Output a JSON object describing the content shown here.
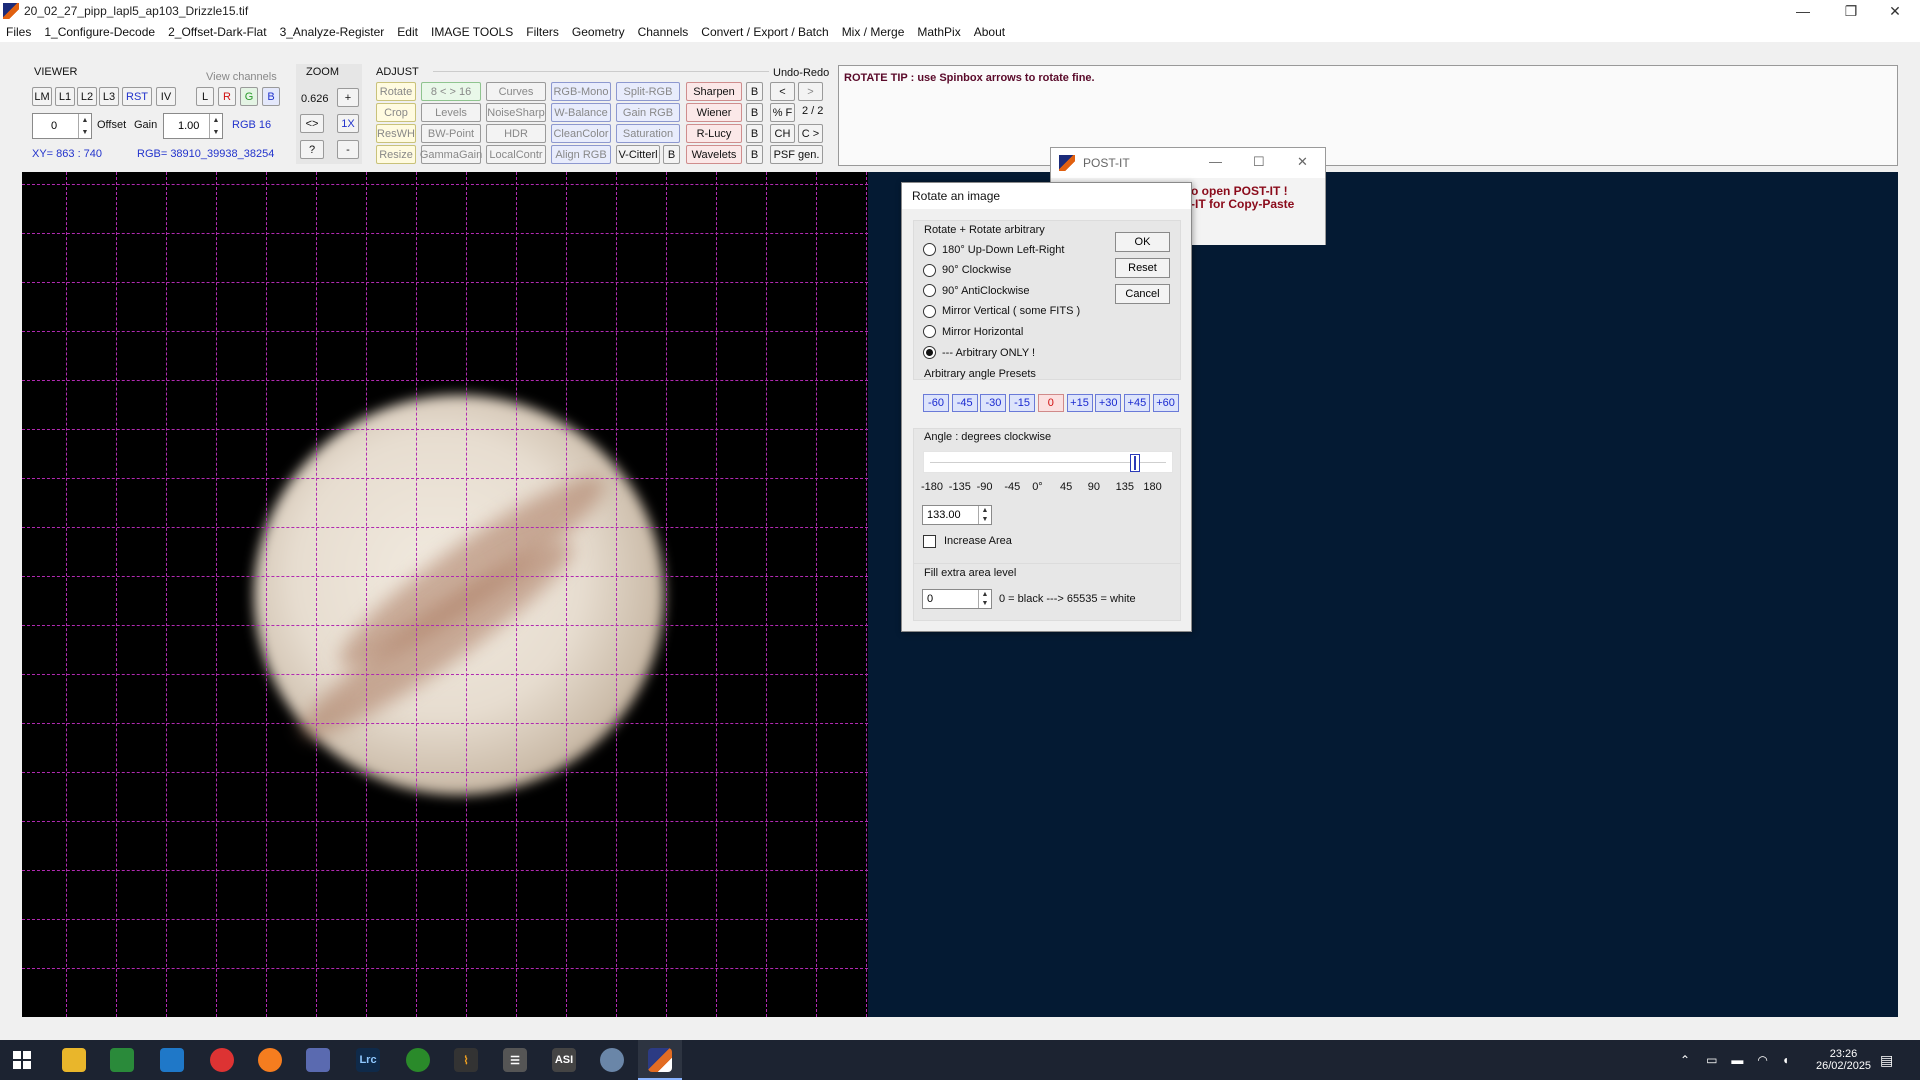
{
  "window": {
    "title": "20_02_27_pipp_lapl5_ap103_Drizzle15.tif",
    "minimize": "—",
    "restore": "❐",
    "close": "✕"
  },
  "menu": [
    "Files",
    "1_Configure-Decode",
    "2_Offset-Dark-Flat",
    "3_Analyze-Register",
    "Edit",
    "IMAGE TOOLS",
    "Filters",
    "Geometry",
    "Channels",
    "Convert / Export / Batch",
    "Mix / Merge",
    "MathPix",
    "About"
  ],
  "viewer": {
    "label": "VIEWER",
    "view_channels_label": "View channels",
    "buttons": [
      "LM",
      "L1",
      "L2",
      "L3",
      "RST",
      "IV"
    ],
    "channels": [
      "L",
      "R",
      "G",
      "B"
    ],
    "offset_value": "0",
    "offset_label": "Offset",
    "gain_label": "Gain",
    "gain_value": "1.00",
    "rgb_depth": "RGB 16",
    "xy": "XY= 863 : 740",
    "rgb": "RGB= 38910_39938_38254"
  },
  "zoom": {
    "label": "ZOOM",
    "value": "0.626",
    "plus": "+",
    "fit": "<>",
    "one_x": "1X",
    "help": "?",
    "minus": "-"
  },
  "adjust": {
    "label": "ADJUST",
    "undo_label": "Undo-Redo",
    "col1": [
      "Rotate",
      "Crop",
      "ResWH",
      "Resize"
    ],
    "col2": [
      "8 < > 16",
      "Levels",
      "BW-Point",
      "GammaGain"
    ],
    "col3": [
      "Curves",
      "NoiseSharp",
      "HDR",
      "LocalContr"
    ],
    "col4": [
      "RGB-Mono",
      "W-Balance",
      "CleanColor",
      "Align RGB"
    ],
    "col5": [
      "Split-RGB",
      "Gain RGB",
      "Saturation",
      "V-Citterl"
    ],
    "col6": [
      "Sharpen",
      "Wiener",
      "R-Lucy",
      "Wavelets"
    ],
    "b_label": "B",
    "undo": "<",
    "redo": ">",
    "pct_f": "% F",
    "undo_count": "2 / 2",
    "ch": "CH",
    "c_next": "C >",
    "psf": "PSF gen."
  },
  "tip": {
    "text": "ROTATE TIP :  use Spinbox arrows to rotate fine."
  },
  "postit": {
    "title": "POST-IT",
    "line1": "o open POST-IT !",
    "line2": "-IT for Copy-Paste"
  },
  "dialog": {
    "title": "Rotate an image",
    "group_label": "Rotate  +  Rotate arbitrary",
    "options": [
      {
        "label": "180°  Up-Down   Left-Right",
        "selected": false
      },
      {
        "label": "90° Clockwise",
        "selected": false
      },
      {
        "label": "90° AntiClockwise",
        "selected": false
      },
      {
        "label": "Mirror Vertical  ( some FITS )",
        "selected": false
      },
      {
        "label": "Mirror Horizontal",
        "selected": false
      },
      {
        "label": "---  Arbitrary ONLY !",
        "selected": true
      }
    ],
    "ok": "OK",
    "reset": "Reset",
    "cancel": "Cancel",
    "presets_label": "Arbitrary angle Presets",
    "presets": [
      "-60",
      "-45",
      "-30",
      "-15",
      "0",
      "+15",
      "+30",
      "+45",
      "+60"
    ],
    "angle_label": "Angle :   degrees clockwise",
    "slider_value": 133,
    "slider_min": -180,
    "slider_max": 180,
    "scale": [
      "-180",
      "-135",
      "-90",
      "-45",
      "0°",
      "45",
      "90",
      "135",
      "180"
    ],
    "angle_value": "133.00",
    "increase_area": "Increase Area",
    "increase_area_checked": false,
    "fill_label": "Fill extra area level",
    "fill_value": "0",
    "fill_hint": "0 = black    --->  65535 = white"
  },
  "taskbar": {
    "time": "23:26",
    "date": "26/02/2025",
    "apps": [
      "windows-start",
      "file-explorer",
      "notepad",
      "vscode",
      "chrome",
      "firefox",
      "network-tool",
      "lightroom-classic",
      "green-app",
      "stylus-app",
      "grey-app",
      "asi-studio",
      "tool-app",
      "astro-app"
    ],
    "labels": {
      "lrc": "Lrc",
      "asi": "ASI"
    }
  },
  "colors": {
    "grid": "#b12ab1",
    "dark_background": "#041a33",
    "accent_blue": "#2233cc",
    "accent_red": "#d01010"
  }
}
